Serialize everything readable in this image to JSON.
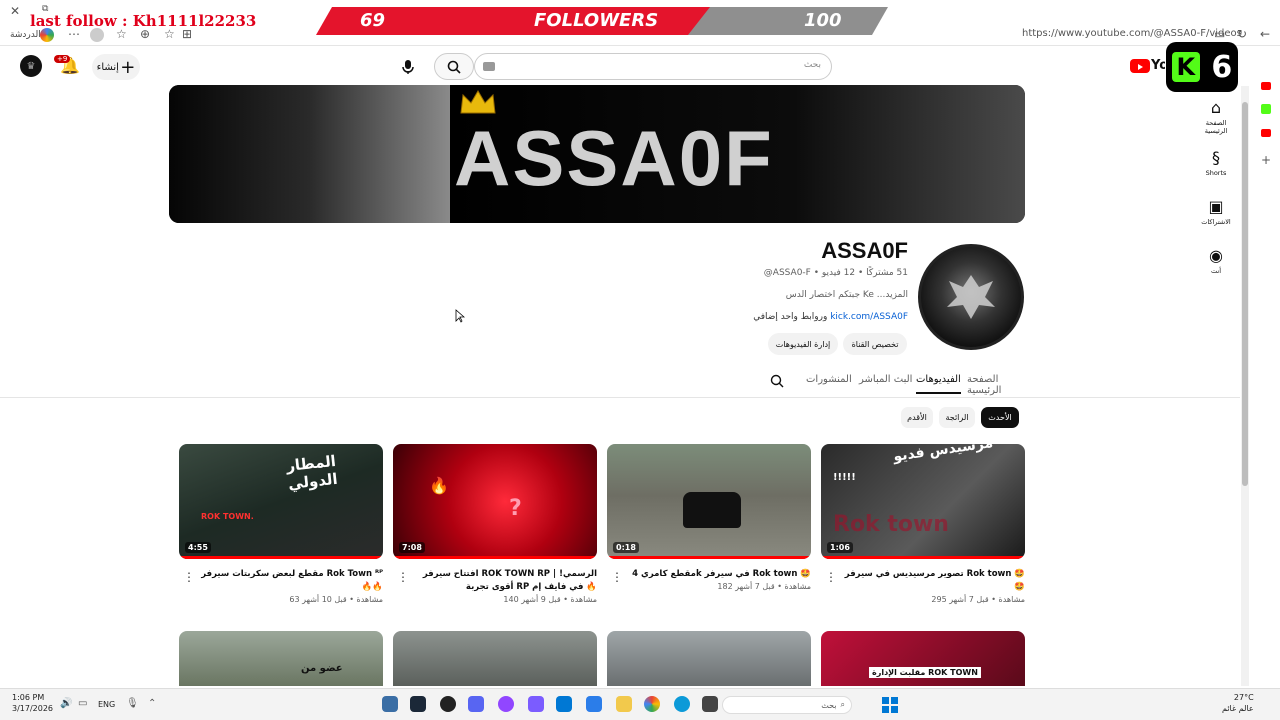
{
  "overlay": {
    "follow_text": "last follow : Kh1111l22233",
    "follower_count": "69",
    "followers_label": "FOLLOWERS",
    "follower_goal": "100",
    "kick_badge_number": "6"
  },
  "browser": {
    "url": "https://www.youtube.com/@ASSA0-F/videos",
    "chat_label": "الدردشة"
  },
  "header": {
    "search_placeholder": "بحث",
    "create_label": "إنشاء",
    "notifications_badge": "+9",
    "logo_text": "YouTube"
  },
  "banner": {
    "logo_text": "ASSA0F"
  },
  "channel": {
    "name": "ASSA0F",
    "meta": "@ASSA0-F • ‏51 مشتركًا • 12 فيديو",
    "description": "جبتكم اختصار الدس Ke ...المزيد",
    "link_url": "kick.com/ASSA0F",
    "link_suffix": "وروابط واحد إضافي",
    "customize_button": "تخصيص القناة",
    "manage_button": "إدارة الفيديوهات"
  },
  "tabs": [
    {
      "label": "الصفحة الرئيسية"
    },
    {
      "label": "الفيديوهات"
    },
    {
      "label": "البث المباشر"
    },
    {
      "label": "المنشورات"
    }
  ],
  "chips": [
    {
      "label": "الأحدث"
    },
    {
      "label": "الرائجة"
    },
    {
      "label": "الأقدم"
    }
  ],
  "videos": [
    {
      "title": "تصوير مرسيديس في سيرفر Rok town 🤩🤩",
      "meta": "295 مشاهدة • قبل 7 أشهر",
      "duration": "1:06",
      "overlay_text": "مرسيدس فديو",
      "overlay_sub": "!!!!!",
      "overlay_bg": "Rok town"
    },
    {
      "title": "مقطع كامري 4k في سيرفر Rok town 🤩",
      "meta": "182 مشاهدة • قبل 7 أشهر",
      "duration": "0:18"
    },
    {
      "title": "افتتاح سيرفر ROK TOWN RP الرسمي! | أقوى تجربة RP في فايف إم 🔥",
      "meta": "140 مشاهدة • قبل 9 أشهر",
      "duration": "7:08",
      "overlay_text": "?"
    },
    {
      "title": "مقطع لبعض سكربتات سيرفر Rok Town ᴿᴾ 🔥🔥",
      "meta": "63 مشاهدة • قبل 10 أشهر",
      "duration": "4:55",
      "overlay_text": "المطار الدولي",
      "overlay_sub": "ROK TOWN."
    }
  ],
  "videos_row2_captions": [
    "عضو من",
    "مقلبت الإدارة ROK TOWN"
  ],
  "sidebar": [
    {
      "label": "الصفحة الرئيسية"
    },
    {
      "label": "Shorts"
    },
    {
      "label": "الاشتراكات"
    },
    {
      "label": "أنت"
    }
  ],
  "taskbar": {
    "time": "1:06 PM",
    "date": "3/17/2026",
    "language": "ENG",
    "search_label": "بحث",
    "temperature": "27°C",
    "weather_label": "عالم غائم"
  },
  "colors": {
    "accent_red": "#e4142c",
    "kick_green": "#53fc18",
    "link_blue": "#065fd4"
  }
}
